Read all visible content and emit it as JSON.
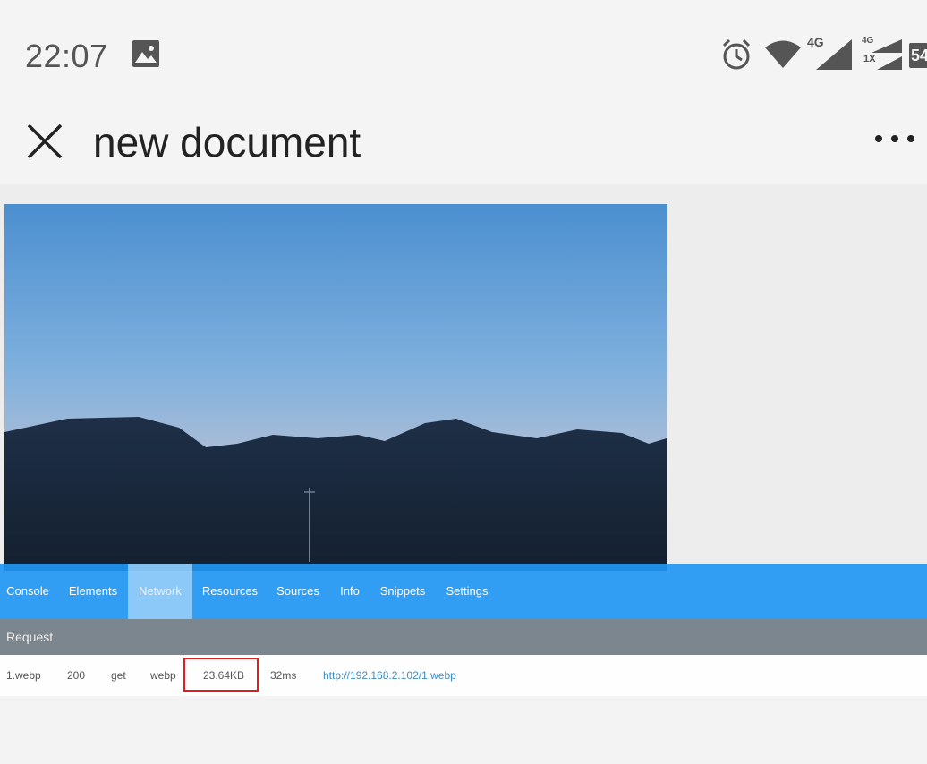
{
  "status_bar": {
    "time": "22:07",
    "icons": [
      "gallery-icon",
      "alarm-icon",
      "wifi-icon",
      "signal-4g-icon",
      "signal-4g-1x-icon",
      "battery-icon"
    ],
    "network_label_1": "4G",
    "network_label_2a": "4G",
    "network_label_2b": "1X",
    "battery_text": "54"
  },
  "app_bar": {
    "title": "new document",
    "close_icon": "close-icon",
    "more_icon": "more-icon"
  },
  "devtools": {
    "tabs": [
      "Console",
      "Elements",
      "Network",
      "Resources",
      "Sources",
      "Info",
      "Snippets",
      "Settings"
    ],
    "active_tab": "Network",
    "request_header": "Request",
    "request_row": {
      "name": "1.webp",
      "status": "200",
      "method": "get",
      "type": "webp",
      "size": "23.64KB",
      "time": "32ms",
      "url": "http://192.168.2.102/1.webp"
    }
  },
  "colors": {
    "tab_bar": "#2196f3",
    "highlight_box": "#e01e1e",
    "url_link": "#3f8bbf"
  }
}
